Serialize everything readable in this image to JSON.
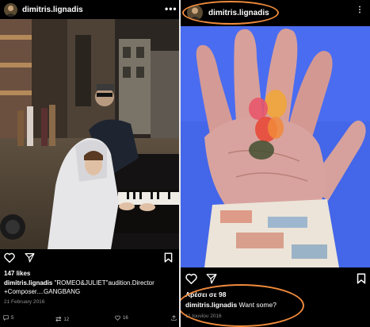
{
  "left_post": {
    "username": "dimitris.lignadis",
    "likes": "147 likes",
    "caption_user": "dimitris.lignadis",
    "caption_text": " \"ROMEO&JULIET\"audition.Director",
    "caption_text2": "+Composer....GANGBANG",
    "date": "21 February 2016",
    "stats": {
      "comments": "5",
      "reposts": "12",
      "likes": "16"
    }
  },
  "right_post": {
    "username": "dimitris.lignadis",
    "likes": "Αρέσει σε 98",
    "caption_user": "dimitris.lignadis",
    "caption_text": " Want some?",
    "date": "11 Ιουνίου 2016"
  },
  "icons": [
    "more-icon",
    "heart-icon",
    "send-icon",
    "bookmark-icon",
    "comment-icon",
    "repost-icon",
    "share-icon"
  ],
  "colors": {
    "highlight": "#f08a3c",
    "background": "#000000",
    "muted_text": "#8e8e8e"
  }
}
